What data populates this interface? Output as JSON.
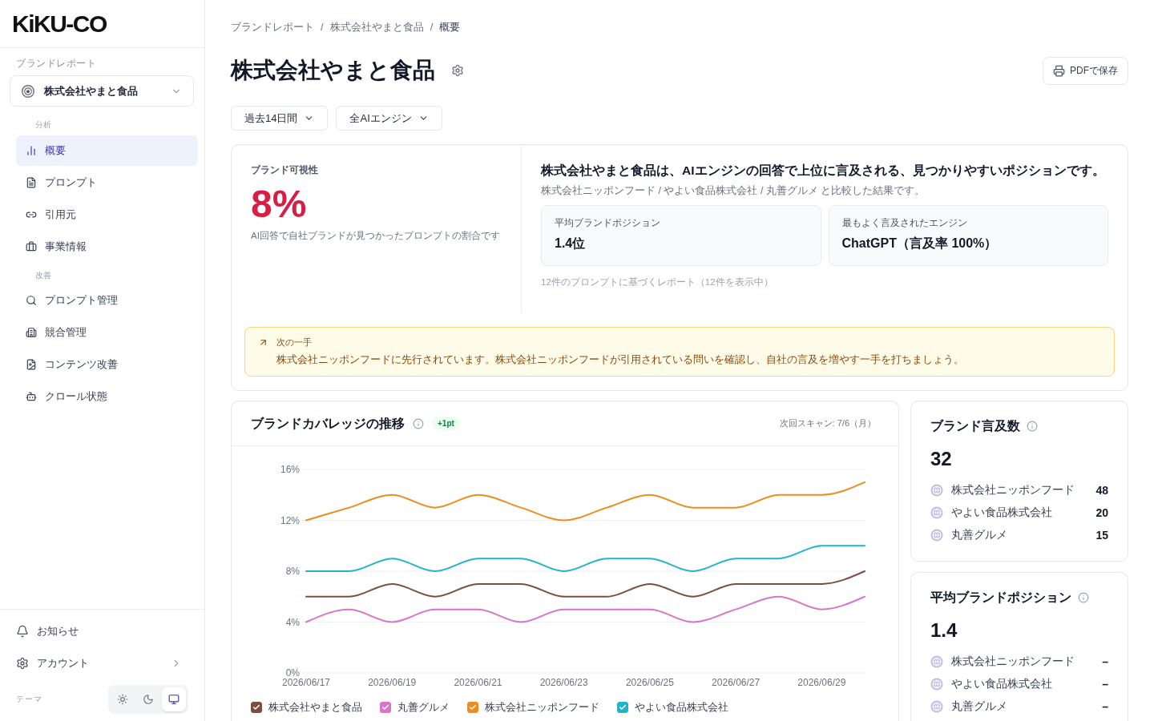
{
  "sidebar": {
    "logo": "KiKU-CO",
    "section_label": "ブランドレポート",
    "brand_selector": {
      "value": "株式会社やまと食品"
    },
    "nav_groups": [
      {
        "label": "分析",
        "items": [
          {
            "label": "概要",
            "selected": true
          },
          {
            "label": "プロンプト",
            "selected": false
          },
          {
            "label": "引用元",
            "selected": false
          },
          {
            "label": "事業情報",
            "selected": false
          }
        ]
      },
      {
        "label": "改善",
        "items": [
          {
            "label": "プロンプト管理",
            "selected": false
          },
          {
            "label": "競合管理",
            "selected": false
          },
          {
            "label": "コンテンツ改善",
            "selected": false
          },
          {
            "label": "クロール状態",
            "selected": false
          }
        ]
      }
    ],
    "footer_items": [
      {
        "label": "お知らせ",
        "kind": "link"
      },
      {
        "label": "アカウント",
        "kind": "submenu"
      }
    ],
    "theme": {
      "label": "テーマ",
      "options": [
        {
          "selected": false
        },
        {
          "selected": false
        },
        {
          "selected": true
        }
      ]
    }
  },
  "breadcrumb": [
    {
      "kind": "link",
      "text": "ブランドレポート"
    },
    {
      "kind": "separator",
      "text": "/"
    },
    {
      "kind": "link",
      "text": "株式会社やまと食品"
    },
    {
      "kind": "separator",
      "text": "/"
    },
    {
      "kind": "current",
      "text": "概要"
    }
  ],
  "page_title": "株式会社やまと食品",
  "pdf_button": "PDFで保存",
  "filters": [
    {
      "label": "過去14日間"
    },
    {
      "label": "全AIエンジン"
    }
  ],
  "visibility": {
    "label": "ブランド可視性",
    "value": "8%",
    "description": "AI回答で自社ブランドが見つかったプロンプトの割合です"
  },
  "summary": {
    "headline": "株式会社やまと食品は、AIエンジンの回答で上位に言及される、見つかりやすいポジションです。",
    "subtitle": "株式会社ニッポンフード / やよい食品株式会社 / 丸善グルメ と比較した結果です。",
    "stats": [
      {
        "label": "平均ブランドポジション",
        "value": "1.4位"
      },
      {
        "label": "最もよく言及されたエンジン",
        "value": "ChatGPT（言及率 100%）"
      }
    ],
    "footnote": "12件のプロンプトに基づくレポート（12件を表示中）"
  },
  "next_step": {
    "label": "次の一手",
    "text": "株式会社ニッポンフードに先行されています。株式会社ニッポンフードが引用されている問いを確認し、自社の言及を増やす一手を打ちましょう。"
  },
  "coverage": {
    "title": "ブランドカバレッジの推移",
    "badge": "+1pt",
    "next_scan": "次回スキャン: 7/6（月）",
    "chart_data": {
      "type": "line",
      "grid": true,
      "categories": [
        "2026/06/17",
        null,
        "2026/06/19",
        null,
        "2026/06/21",
        null,
        "2026/06/23",
        null,
        "2026/06/25",
        null,
        "2026/06/27",
        null,
        "2026/06/29",
        null
      ],
      "ylim": [
        0,
        16
      ],
      "yticks": [
        {
          "value": 0,
          "label": "0%"
        },
        {
          "value": 4,
          "label": "4%"
        },
        {
          "value": 8,
          "label": "8%"
        },
        {
          "value": 12,
          "label": "12%"
        },
        {
          "value": 16,
          "label": "16%"
        }
      ],
      "series": [
        {
          "name": "株式会社やまと食品",
          "color": "#7d4e3f",
          "values": [
            6,
            6,
            7,
            6,
            7,
            7,
            6,
            6,
            7,
            6,
            7,
            7,
            7,
            8
          ]
        },
        {
          "name": "丸善グルメ",
          "color": "#d874cc",
          "values": [
            4,
            5,
            4,
            5,
            5,
            4,
            5,
            5,
            5,
            4,
            5,
            6,
            5,
            6
          ]
        },
        {
          "name": "株式会社ニッポンフード",
          "color": "#ee8c1c",
          "values": [
            12,
            13,
            14,
            13,
            14,
            13,
            12,
            13,
            14,
            13,
            13,
            14,
            14,
            15
          ]
        },
        {
          "name": "やよい食品株式会社",
          "color": "#22b5c9",
          "values": [
            8,
            8,
            9,
            8,
            9,
            9,
            8,
            9,
            9,
            8,
            9,
            9,
            10,
            10
          ]
        }
      ]
    },
    "legend": [
      {
        "checked": true
      },
      {
        "checked": true
      },
      {
        "checked": true
      },
      {
        "checked": true
      }
    ]
  },
  "mention_count": {
    "title": "ブランド言及数",
    "value": "32",
    "competitors": [
      {
        "name": "株式会社ニッポンフード",
        "value": "48"
      },
      {
        "name": "やよい食品株式会社",
        "value": "20"
      },
      {
        "name": "丸善グルメ",
        "value": "15"
      }
    ]
  },
  "average_position": {
    "title": "平均ブランドポジション",
    "value": "1.4",
    "competitors": [
      {
        "name": "株式会社ニッポンフード",
        "value": "–"
      },
      {
        "name": "やよい食品株式会社",
        "value": "–"
      },
      {
        "name": "丸善グルメ",
        "value": "–"
      }
    ]
  }
}
